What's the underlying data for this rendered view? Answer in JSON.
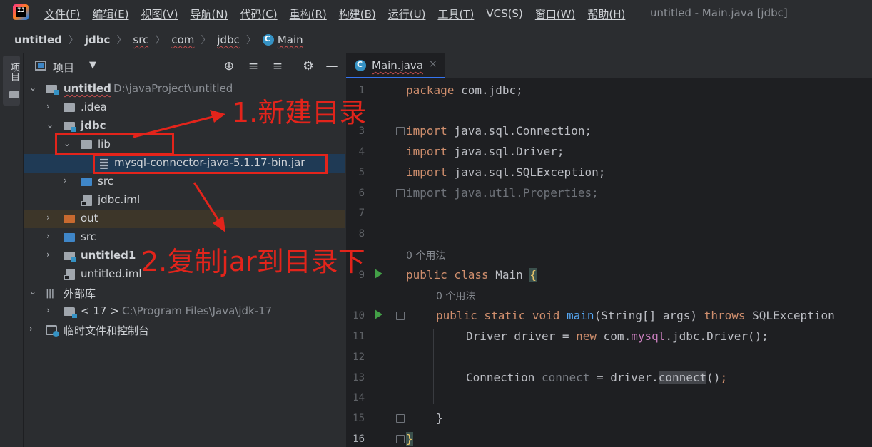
{
  "menubar": {
    "logo_text": "IJ",
    "items": [
      "文件(F)",
      "编辑(E)",
      "视图(V)",
      "导航(N)",
      "代码(C)",
      "重构(R)",
      "构建(B)",
      "运行(U)",
      "工具(T)",
      "VCS(S)",
      "窗口(W)",
      "帮助(H)"
    ],
    "window_title": "untitled - Main.java [jdbc]"
  },
  "breadcrumb": [
    "untitled",
    "jdbc",
    "src",
    "com",
    "jdbc",
    "Main"
  ],
  "side_stripe": {
    "label": "项目"
  },
  "project_panel": {
    "title": "项目",
    "dropdown": "▼",
    "tools": {
      "locate": "⊕",
      "expand": "≡",
      "collapse": "≡",
      "settings": "⚙",
      "hide": "—"
    },
    "tree": [
      {
        "name": "untitled",
        "extra": "D:\\javaProject\\untitled"
      },
      {
        "name": ".idea"
      },
      {
        "name": "jdbc"
      },
      {
        "name": "lib"
      },
      {
        "name": "mysql-connector-java-5.1.17-bin.jar"
      },
      {
        "name": "src"
      },
      {
        "name": "jdbc.iml"
      },
      {
        "name": "out"
      },
      {
        "name": "src"
      },
      {
        "name": "untitled1"
      },
      {
        "name": "untitled.iml"
      },
      {
        "name": "外部库"
      },
      {
        "name": "< 17 >",
        "extra": "C:\\Program Files\\Java\\jdk-17"
      },
      {
        "name": "临时文件和控制台"
      }
    ]
  },
  "annotations": {
    "step1": "1.新建目录",
    "step2": "2.复制jar到目录下",
    "color": "#e3241b"
  },
  "editor": {
    "tab_label": "Main.java",
    "tab_close": "×",
    "usage_hint": "0 个用法",
    "line_numbers": [
      "1",
      "3",
      "4",
      "5",
      "6",
      "7",
      "8",
      "9",
      "10",
      "11",
      "12",
      "13",
      "14",
      "15",
      "16"
    ],
    "code": {
      "l1": [
        "package",
        " com.jdbc;"
      ],
      "l3": [
        "import",
        " java.sql.Connection;"
      ],
      "l4": [
        "import",
        " java.sql.Driver;"
      ],
      "l5": [
        "import",
        " java.sql.SQLException;"
      ],
      "l6": [
        "import",
        " java.util.Properties;"
      ],
      "l9": [
        "public class",
        " Main ",
        "{"
      ],
      "l10": [
        "public static void",
        " main",
        "(String[] args) ",
        "throws",
        " SQLException"
      ],
      "l11": [
        "Driver driver = ",
        "new",
        " com.",
        "mysql",
        ".jdbc.Driver();"
      ],
      "l13": [
        "Connection ",
        "connect",
        " = driver.",
        "connect",
        "(",
        ")",
        ";"
      ],
      "l15": [
        "}"
      ],
      "l16": [
        "}"
      ]
    }
  },
  "colors": {
    "background": "#2b2d30",
    "editor_bg": "#1e1f22",
    "keyword": "#cf8e6d",
    "function": "#56a8f5",
    "selection": "#1f3a55",
    "annotation": "#e3241b"
  }
}
